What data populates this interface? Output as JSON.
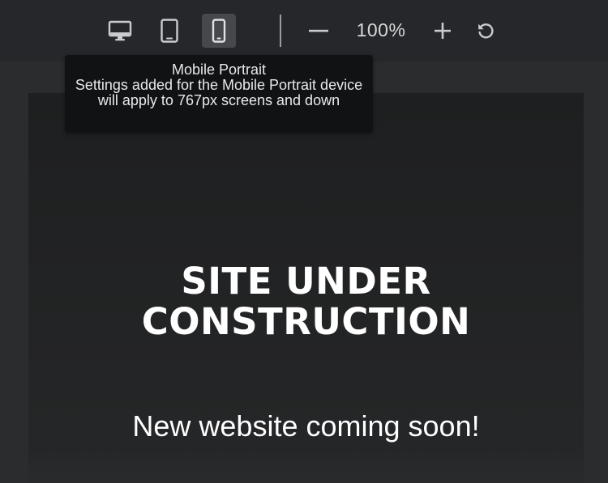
{
  "toolbar": {
    "devices": [
      {
        "id": "desktop",
        "icon": "desktop-icon",
        "active": false
      },
      {
        "id": "tablet",
        "icon": "tablet-icon",
        "active": false
      },
      {
        "id": "mobile",
        "icon": "mobile-icon",
        "active": true
      }
    ],
    "zoom_out_icon": "minus-icon",
    "zoom_level": "100%",
    "zoom_in_icon": "plus-icon",
    "reset_icon": "reset-icon"
  },
  "tooltip": {
    "title": "Mobile Portrait",
    "body": "Settings added for the Mobile Portrait device will apply to 767px screens and down"
  },
  "preview": {
    "heading": "SITE UNDER CONSTRUCTION",
    "subheading": "New website coming soon!"
  },
  "colors": {
    "toolbar_bg": "#26272a",
    "canvas_bg": "#2b2c2e",
    "frame_bg": "#1f2021",
    "active_button_bg": "#46484c",
    "tooltip_bg": "#111213",
    "text": "#ffffff"
  }
}
